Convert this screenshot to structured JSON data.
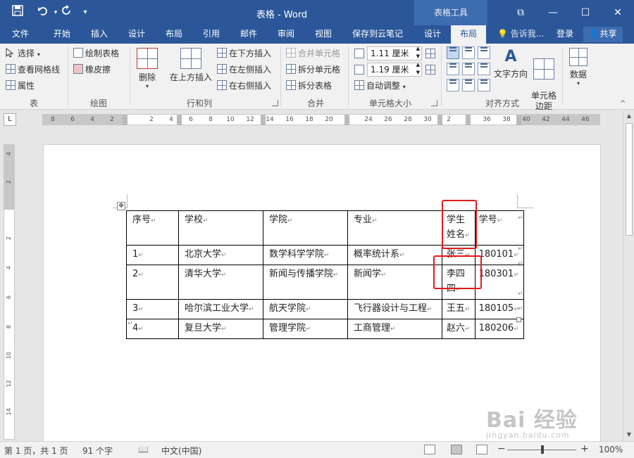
{
  "titlebar": {
    "title": "表格 - Word",
    "context_group": "表格工具",
    "save_icon": "save-icon",
    "undo_icon": "undo-icon",
    "redo_icon": "redo-icon",
    "qat_more": "▾",
    "restore_glyph": "⧉",
    "minimize_glyph": "—",
    "maximize_glyph": "☐",
    "close_glyph": "✕"
  },
  "tabs": [
    "文件",
    "开始",
    "插入",
    "设计",
    "布局",
    "引用",
    "邮件",
    "审阅",
    "视图",
    "保存到云笔记",
    "设计",
    "布局"
  ],
  "active_tab_index": 11,
  "tell_me": "告诉我...",
  "login": "登录",
  "share": "共享",
  "ribbon": {
    "table_group": {
      "select": "选择",
      "view_gridlines": "查看网格线",
      "properties": "属性",
      "label": "表"
    },
    "draw_group": {
      "draw_table": "绘制表格",
      "eraser": "橡皮擦",
      "label": "绘图"
    },
    "rows_cols_group": {
      "delete": "删除",
      "insert_above": "在上方插入",
      "insert_below": "在下方插入",
      "insert_left": "在左侧插入",
      "insert_right": "在右侧插入",
      "label": "行和列"
    },
    "merge_group": {
      "merge_cells": "合并单元格",
      "split_cells": "拆分单元格",
      "split_table": "拆分表格",
      "label": "合并"
    },
    "cell_size_group": {
      "height": "1.11 厘米",
      "width": "1.19 厘米",
      "autofit": "自动调整",
      "label": "单元格大小"
    },
    "alignment_group": {
      "text_direction": "文字方向",
      "cell_margins": "单元格\n边距",
      "label": "对齐方式"
    },
    "data_group": {
      "data": "数据"
    }
  },
  "ruler": {
    "left_ticks": [
      "8",
      "6",
      "4",
      "2"
    ],
    "right_ticks": [
      "2",
      "4",
      "6",
      "8",
      "10",
      "12",
      "14",
      "16",
      "18",
      "20",
      "22",
      "24",
      "26",
      "28",
      "30",
      "32",
      "34",
      "36",
      "38",
      "40",
      "42",
      "44",
      "46"
    ],
    "vertical_ticks": [
      "4",
      "2",
      "2",
      "4",
      "6",
      "8",
      "10",
      "12",
      "14",
      "16",
      "18"
    ],
    "corner_glyph": "L"
  },
  "table": {
    "rows": [
      [
        "序号",
        "学校",
        "学院",
        "专业",
        "学生姓名",
        "学号"
      ],
      [
        "1",
        "北京大学",
        "数学科学学院",
        "概率统计系",
        "张三",
        "180101"
      ],
      [
        "2",
        "清华大学",
        "新闻与传播学院",
        "新闻学",
        "李四",
        "180301"
      ],
      [
        "3",
        "哈尔滨工业大学",
        "航天学院",
        "飞行器设计与工程",
        "王五",
        "180105"
      ],
      [
        "4",
        "复旦大学",
        "管理学院",
        "工商管理",
        "赵六",
        "180206"
      ]
    ],
    "wrapped_cells": {
      "header_name": [
        "学生",
        "姓名"
      ],
      "row2_name": [
        "李四",
        "四"
      ]
    },
    "paragraph_mark": "↵",
    "move_handle_glyph": "✥"
  },
  "highlight_color": "#e21a1a",
  "accent_color": "#2b579a",
  "watermark": {
    "main": "Bai 经验",
    "sub": "jingyan.baidu.com"
  },
  "status": {
    "page": "第 1 页，共 1 页",
    "words": "91 个字",
    "language": "中文(中国)",
    "zoom": "100%",
    "zoom_minus": "−",
    "zoom_plus": "+"
  }
}
